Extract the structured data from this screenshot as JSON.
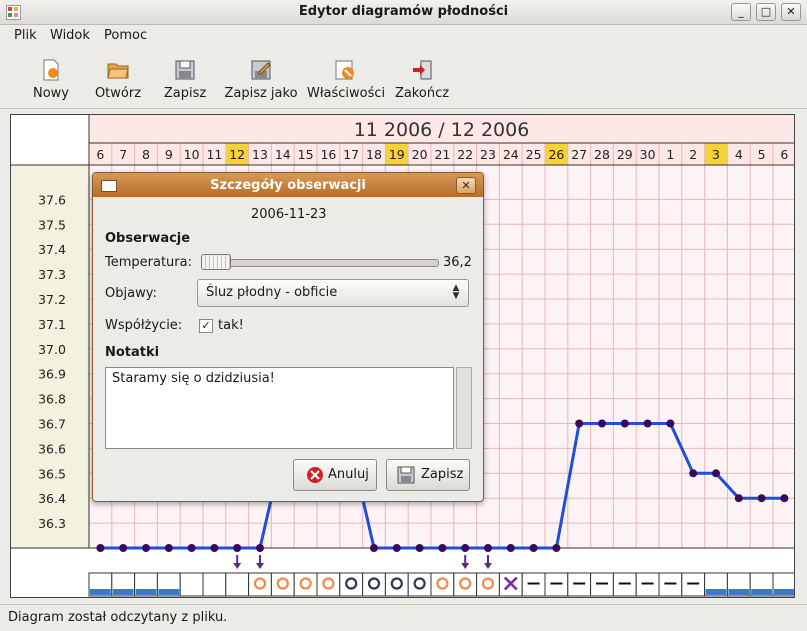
{
  "window": {
    "title": "Edytor diagramów płodności"
  },
  "menu": {
    "items": [
      "Plik",
      "Widok",
      "Pomoc"
    ]
  },
  "toolbar": {
    "buttons": [
      {
        "label": "Nowy",
        "icon": "new-icon"
      },
      {
        "label": "Otwórz",
        "icon": "open-folder-icon"
      },
      {
        "label": "Zapisz",
        "icon": "save-floppy-icon"
      },
      {
        "label": "Zapisz jako",
        "icon": "save-as-icon"
      },
      {
        "label": "Właściwości",
        "icon": "properties-icon"
      },
      {
        "label": "Zakończ",
        "icon": "quit-icon"
      }
    ]
  },
  "chart_data": {
    "type": "line",
    "title": "11 2006 / 12 2006",
    "days": [
      "6",
      "7",
      "8",
      "9",
      "10",
      "11",
      "12",
      "13",
      "14",
      "15",
      "16",
      "17",
      "18",
      "19",
      "20",
      "21",
      "22",
      "23",
      "24",
      "25",
      "26",
      "27",
      "28",
      "29",
      "30",
      "1",
      "2",
      "3",
      "4",
      "5",
      "6"
    ],
    "highlighted_days": [
      "12",
      "19",
      "26",
      "3"
    ],
    "y_ticks": [
      "37.6",
      "37.5",
      "37.4",
      "37.3",
      "37.2",
      "37.1",
      "37.0",
      "36.9",
      "36.8",
      "36.7",
      "36.6",
      "36.5",
      "36.4",
      "36.3"
    ],
    "ylim": [
      36.2,
      37.7
    ],
    "series": [
      {
        "values": [
          36.2,
          36.2,
          36.2,
          36.2,
          36.2,
          36.2,
          36.2,
          36.2,
          36.6,
          36.8,
          36.8,
          36.6,
          36.2,
          36.2,
          36.2,
          36.2,
          36.2,
          36.2,
          36.2,
          36.2,
          36.2,
          36.7,
          36.7,
          36.7,
          36.7,
          36.7,
          36.5,
          36.5,
          36.4,
          36.4,
          36.4
        ]
      }
    ],
    "intercourse_arrow_days": [
      "12",
      "13",
      "22",
      "23"
    ],
    "observation_symbols": [
      "none",
      "none",
      "none",
      "none",
      "none",
      "none",
      "none",
      "ring-orange",
      "ring-orange",
      "ring-orange",
      "ring-orange",
      "ring-dark",
      "ring-dark",
      "ring-dark",
      "ring-dark",
      "ring-orange",
      "ring-orange",
      "ring-orange",
      "cross",
      "dash",
      "dash",
      "dash",
      "dash",
      "dash",
      "dash",
      "dash",
      "dash",
      "none",
      "none",
      "none",
      "none"
    ],
    "bleeding_levels": [
      1,
      1,
      1,
      1,
      0,
      0,
      0,
      0,
      0,
      0,
      0,
      0,
      0,
      0,
      0,
      0,
      0,
      0,
      0,
      0,
      0,
      0,
      0,
      0,
      0,
      0,
      0,
      1,
      1,
      1,
      1
    ]
  },
  "dialog": {
    "title": "Szczegóły obserwacji",
    "date": "2006-11-23",
    "section_observations": "Obserwacje",
    "temperature_label": "Temperatura:",
    "temperature_value": "36,2",
    "symptoms_label": "Objawy:",
    "symptoms_value": "Śluz płodny - obficie",
    "intercourse_label": "Współżycie:",
    "intercourse_checked": "✓",
    "intercourse_value": "tak!",
    "notes_label": "Notatki",
    "notes_value": "Staramy się o dzidziusia!",
    "cancel_label": "Anuluj",
    "save_label": "Zapisz"
  },
  "status": {
    "text": "Diagram został odczytany z pliku."
  }
}
